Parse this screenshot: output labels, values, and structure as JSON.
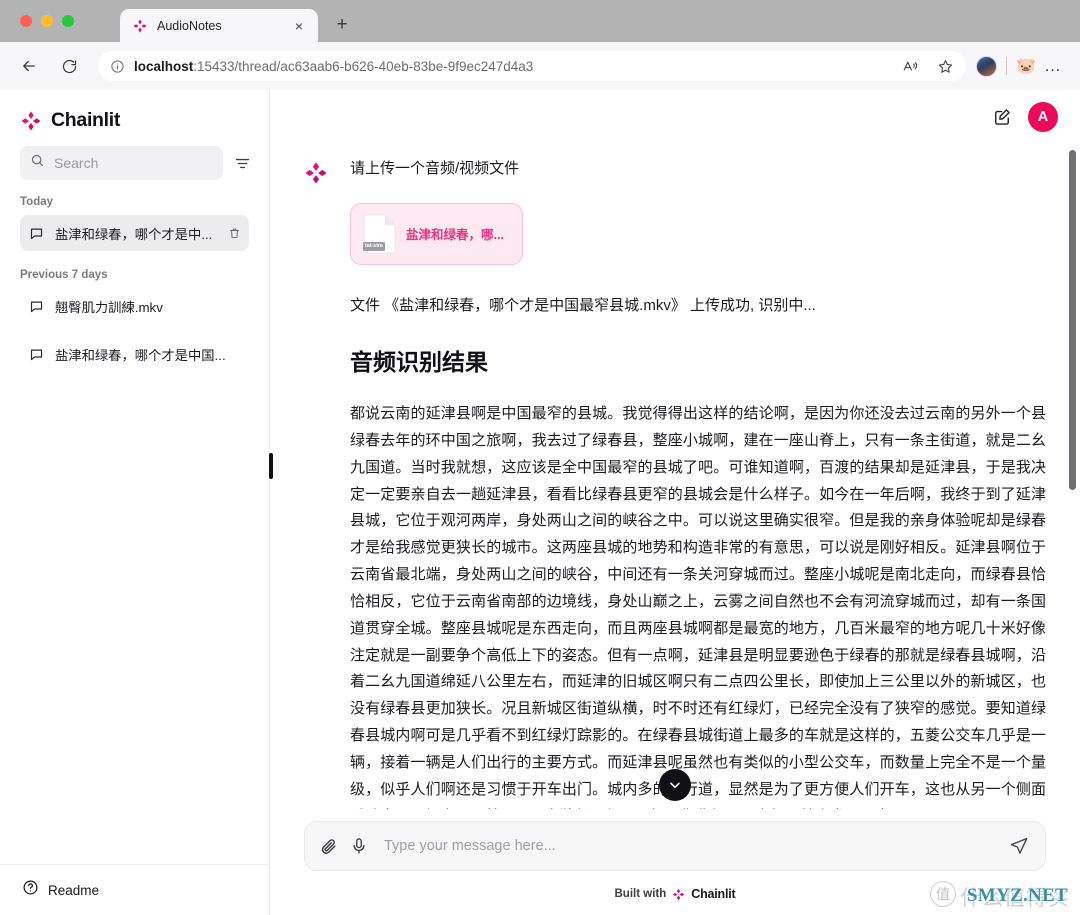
{
  "browser": {
    "tab": {
      "title": "AudioNotes",
      "favicon": "chainlit-logo-icon",
      "close": "×"
    },
    "newtab_label": "+",
    "url_host": "localhost",
    "url_rest": ":15433/thread/ac63aab6-b626-40eb-83be-9f9ec247d4a3",
    "back_label": "←",
    "reload_label": "⟳",
    "readaloud_label": "A",
    "favorite_label": "☆",
    "extension_label": "🐷",
    "more_label": "…"
  },
  "sidebar": {
    "brand": "Chainlit",
    "search": {
      "placeholder": "Search"
    },
    "filter_label": "filter",
    "groups": [
      {
        "label": "Today",
        "items": [
          {
            "label": "盐津和绿春，哪个才是中...",
            "active": true,
            "deletable": true
          }
        ]
      },
      {
        "label": "Previous 7 days",
        "items": [
          {
            "label": "翹臀肌力訓練.mkv",
            "active": false,
            "deletable": false
          },
          {
            "label": "盐津和绿春，哪个才是中国...",
            "active": false,
            "deletable": false
          }
        ]
      }
    ],
    "footer": {
      "readme": "Readme"
    }
  },
  "header": {
    "new_chat_label": "new chat",
    "avatar_initial": "A",
    "avatar_color": "#eb0a5a"
  },
  "conversation": {
    "prompt": "请上传一个音频/视频文件",
    "file_card": {
      "name": "盐津和绿春，哪...",
      "badge": "tat-stre",
      "accent": "#e8357f",
      "background": "#fde9f2"
    },
    "upload_note": "文件 《盐津和绿春，哪个才是中国最窄县城.mkv》 上传成功, 识别中...",
    "section_title": "音频识别结果",
    "transcript": "都说云南的延津县啊是中国最窄的县城。我觉得得出这样的结论啊，是因为你还没去过云南的另外一个县绿春去年的环中国之旅啊，我去过了绿春县，整座小城啊，建在一座山脊上，只有一条主街道，就是二幺九国道。当时我就想，这应该是全中国最窄的县城了吧。可谁知道啊，百渡的结果却是延津县，于是我决定一定要亲自去一趟延津县，看看比绿春县更窄的县城会是什么样子。如今在一年后啊，我终于到了延津县城，它位于观河两岸，身处两山之间的峡谷之中。可以说这里确实很窄。但是我的亲身体验呢却是绿春才是给我感觉更狭长的城市。这两座县城的地势和构造非常的有意思，可以说是刚好相反。延津县啊位于云南省最北端，身处两山之间的峡谷，中间还有一条关河穿城而过。整座小城呢是南北走向，而绿春县恰恰相反，它位于云南省南部的边境线，身处山巅之上，云雾之间自然也不会有河流穿城而过，却有一条国道贯穿全城。整座县城呢是东西走向，而且两座县城啊都是最宽的地方，几百米最窄的地方呢几十米好像注定就是一副要争个高低上下的姿态。但有一点啊，延津县是明显要逊色于绿春的那就是绿春县城啊，沿着二幺九国道绵延八公里左右，而延津的旧城区啊只有二点四公里长，即使加上三公里以外的新城区，也没有绿春县更加狭长。况且新城区街道纵横，时不时还有红绿灯，已经完全没有了狭窄的感觉。要知道绿春县城内啊可是几乎看不到红绿灯踪影的。在绿春县城街道上最多的车就是这样的，五菱公交车几乎是一辆，接着一辆是人们出行的主要方式。而延津县呢虽然也有类似的小型公交车，而数量上完全不是一个量级，似乎人们啊还是习惯于开车出门。城内多的单行道，显然是为了更方便人们开车，这也从另一个侧面反映出啊，绿春县显然是要更为狭长。但是啊如果你非起了无人机，就会发现，由于"
  },
  "composer": {
    "attach_label": "attach file",
    "mic_label": "microphone",
    "placeholder": "Type your message here...",
    "send_label": "send"
  },
  "footer": {
    "built_with": "Built with",
    "brand": "Chainlit"
  },
  "scroll_to_bottom_label": "scroll to bottom",
  "watermark": {
    "mark": "值",
    "text": "什么值得买",
    "site": "SMYZ.NET"
  }
}
